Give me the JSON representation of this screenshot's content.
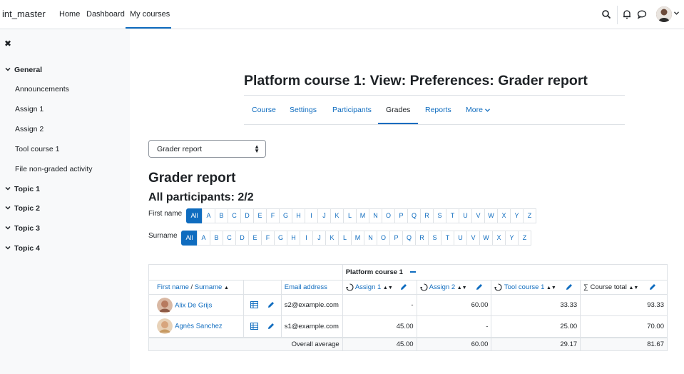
{
  "navbar": {
    "brand": "int_master",
    "links": [
      "Home",
      "Dashboard",
      "My courses"
    ]
  },
  "drawer": {
    "close_glyph": "✖",
    "sections": [
      {
        "label": "General",
        "items": [
          "Announcements",
          "Assign 1",
          "Assign 2",
          "Tool course 1",
          "File non-graded activity"
        ]
      },
      {
        "label": "Topic 1"
      },
      {
        "label": "Topic 2"
      },
      {
        "label": "Topic 3"
      },
      {
        "label": "Topic 4"
      }
    ]
  },
  "page": {
    "title": "Platform course 1: View: Preferences: Grader report",
    "subnav": [
      "Course",
      "Settings",
      "Participants",
      "Grades",
      "Reports",
      "More"
    ],
    "report_select": "Grader report",
    "heading": "Grader report",
    "participants": "All participants: 2/2"
  },
  "initials": {
    "first_label": "First name",
    "surname_label": "Surname",
    "all": "All",
    "letters": [
      "A",
      "B",
      "C",
      "D",
      "E",
      "F",
      "G",
      "H",
      "I",
      "J",
      "K",
      "L",
      "M",
      "N",
      "O",
      "P",
      "Q",
      "R",
      "S",
      "T",
      "U",
      "V",
      "W",
      "X",
      "Y",
      "Z"
    ]
  },
  "table": {
    "category": "Platform course 1",
    "headers": {
      "first_name": "First name",
      "slash": " / ",
      "surname": "Surname",
      "email": "Email address",
      "assign1": "Assign 1",
      "assign2": "Assign 2",
      "tool1": "Tool course 1",
      "total": "Course total",
      "sigma": "∑"
    },
    "rows": [
      {
        "name": "Alix De Grijs",
        "email": "s2@example.com",
        "assign1": "-",
        "assign2": "60.00",
        "tool1": "33.33",
        "total": "93.33"
      },
      {
        "name": "Agnès Sanchez",
        "email": "s1@example.com",
        "assign1": "45.00",
        "assign2": "-",
        "tool1": "25.00",
        "total": "70.00"
      }
    ],
    "average": {
      "label": "Overall average",
      "assign1": "45.00",
      "assign2": "60.00",
      "tool1": "29.17",
      "total": "81.67"
    }
  },
  "colors": {
    "accent": "#0f6cbf",
    "drawer_bg": "#f8f9fa",
    "border": "#dee2e6"
  }
}
